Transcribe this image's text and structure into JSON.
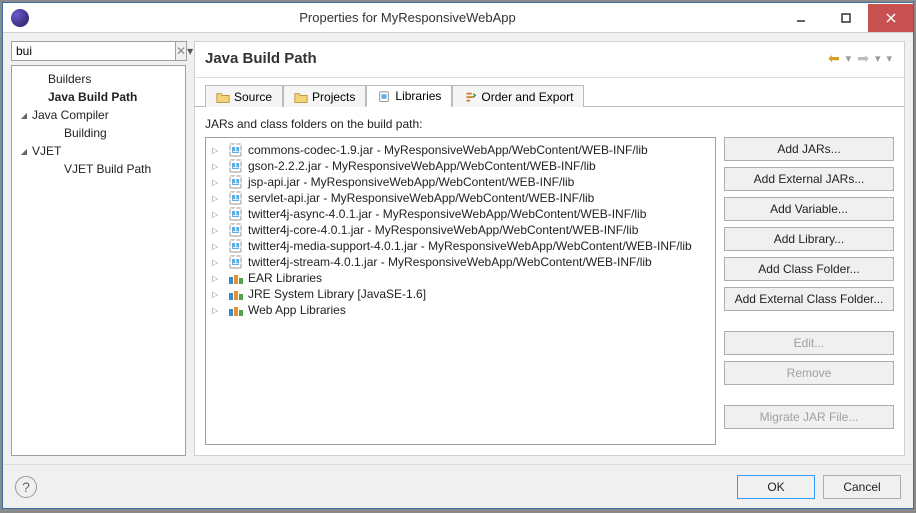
{
  "window": {
    "title": "Properties for MyResponsiveWebApp"
  },
  "search": {
    "value": "bui"
  },
  "nav": {
    "items": [
      {
        "label": "Builders",
        "indent": 1,
        "expand": null,
        "sel": false
      },
      {
        "label": "Java Build Path",
        "indent": 1,
        "expand": null,
        "sel": true
      },
      {
        "label": "Java Compiler",
        "indent": 0,
        "expand": "open",
        "sel": false
      },
      {
        "label": "Building",
        "indent": 2,
        "expand": null,
        "sel": false
      },
      {
        "label": "VJET",
        "indent": 0,
        "expand": "open",
        "sel": false
      },
      {
        "label": "VJET Build Path",
        "indent": 2,
        "expand": null,
        "sel": false
      }
    ]
  },
  "page": {
    "title": "Java Build Path"
  },
  "tabs": [
    {
      "label": "Source",
      "icon": "folder",
      "active": false
    },
    {
      "label": "Projects",
      "icon": "folder",
      "active": false
    },
    {
      "label": "Libraries",
      "icon": "jar",
      "active": true
    },
    {
      "label": "Order and Export",
      "icon": "order",
      "active": false
    }
  ],
  "libraries": {
    "label": "JARs and class folders on the build path:",
    "items": [
      {
        "type": "jar",
        "label": "commons-codec-1.9.jar - MyResponsiveWebApp/WebContent/WEB-INF/lib"
      },
      {
        "type": "jar",
        "label": "gson-2.2.2.jar - MyResponsiveWebApp/WebContent/WEB-INF/lib"
      },
      {
        "type": "jar",
        "label": "jsp-api.jar - MyResponsiveWebApp/WebContent/WEB-INF/lib"
      },
      {
        "type": "jar",
        "label": "servlet-api.jar - MyResponsiveWebApp/WebContent/WEB-INF/lib"
      },
      {
        "type": "jar",
        "label": "twitter4j-async-4.0.1.jar - MyResponsiveWebApp/WebContent/WEB-INF/lib"
      },
      {
        "type": "jar",
        "label": "twitter4j-core-4.0.1.jar - MyResponsiveWebApp/WebContent/WEB-INF/lib"
      },
      {
        "type": "jar",
        "label": "twitter4j-media-support-4.0.1.jar - MyResponsiveWebApp/WebContent/WEB-INF/lib"
      },
      {
        "type": "jar",
        "label": "twitter4j-stream-4.0.1.jar - MyResponsiveWebApp/WebContent/WEB-INF/lib"
      },
      {
        "type": "libset",
        "label": "EAR Libraries"
      },
      {
        "type": "libset",
        "label": "JRE System Library [JavaSE-1.6]"
      },
      {
        "type": "libset",
        "label": "Web App Libraries"
      }
    ]
  },
  "buttons": {
    "add_jars": "Add JARs...",
    "add_ext_jars": "Add External JARs...",
    "add_var": "Add Variable...",
    "add_lib": "Add Library...",
    "add_class": "Add Class Folder...",
    "add_ext_class": "Add External Class Folder...",
    "edit": "Edit...",
    "remove": "Remove",
    "migrate": "Migrate JAR File..."
  },
  "footer": {
    "ok": "OK",
    "cancel": "Cancel"
  }
}
